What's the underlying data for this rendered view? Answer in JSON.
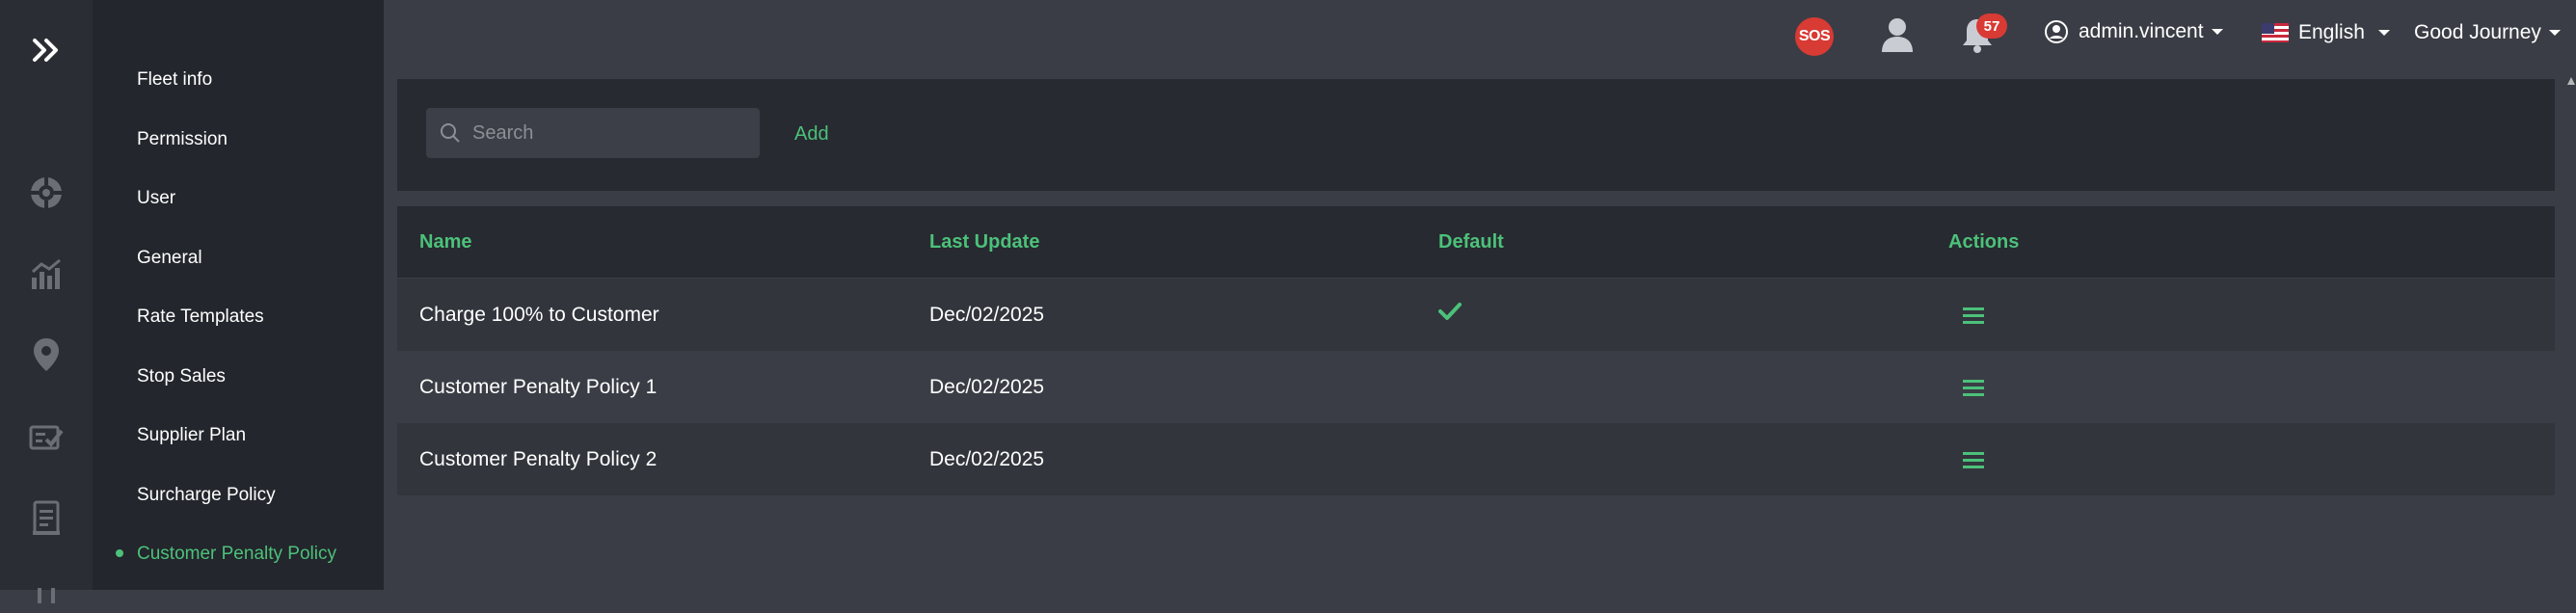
{
  "sidebar": {
    "items": [
      {
        "label": "Fleet info",
        "active": false
      },
      {
        "label": "Permission",
        "active": false
      },
      {
        "label": "User",
        "active": false
      },
      {
        "label": "General",
        "active": false
      },
      {
        "label": "Rate Templates",
        "active": false
      },
      {
        "label": "Stop Sales",
        "active": false
      },
      {
        "label": "Supplier Plan",
        "active": false
      },
      {
        "label": "Surcharge Policy",
        "active": false
      },
      {
        "label": "Customer Penalty Policy",
        "active": true
      }
    ]
  },
  "rail": {
    "icons": [
      "expand-icon",
      "support-icon",
      "analytics-icon",
      "location-icon",
      "tasks-icon",
      "document-icon"
    ]
  },
  "header": {
    "sos_label": "SOS",
    "notification_count": "57",
    "account_name": "admin.vincent",
    "language": "English",
    "company": "Good Journey"
  },
  "toolbar": {
    "search_placeholder": "Search",
    "add_label": "Add"
  },
  "table": {
    "columns": [
      "Name",
      "Last Update",
      "Default",
      "Actions"
    ],
    "rows": [
      {
        "name": "Charge 100% to Customer",
        "last_update": "Dec/02/2025",
        "default": true
      },
      {
        "name": "Customer Penalty Policy 1",
        "last_update": "Dec/02/2025",
        "default": false
      },
      {
        "name": "Customer Penalty Policy 2",
        "last_update": "Dec/02/2025",
        "default": false
      }
    ]
  },
  "colors": {
    "accent": "#4cc17a",
    "alert": "#d83a34",
    "sidebar_bg": "#23262c",
    "page_bg": "#3a3d45"
  }
}
